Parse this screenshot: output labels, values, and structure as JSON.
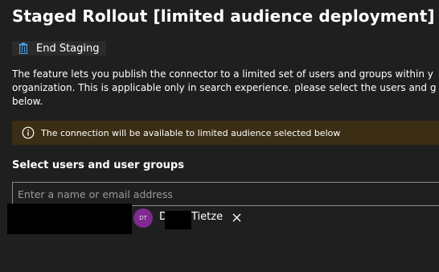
{
  "page": {
    "title": "Staged Rollout [limited audience deployment]"
  },
  "toolbar": {
    "end_staging_label": "End Staging",
    "end_staging_icon": "trash-icon"
  },
  "description": {
    "line1": "The feature lets you publish the connector to a limited set of users and groups within y",
    "line2": "organization. This is applicable only in search experience. please select the users and g",
    "line3": "below."
  },
  "banner": {
    "icon": "info-icon",
    "text": "The connection will be available to limited audience selected below",
    "background": "#3b2e15"
  },
  "selector": {
    "label": "Select users and user groups",
    "placeholder": "Enter a name or email address",
    "value": ""
  },
  "selected_users": [
    {
      "initials": "DT",
      "name_visible_prefix": "D",
      "name_visible_suffix": "Tietze",
      "avatar_color": "#7e2a8f",
      "remove_icon": "close-icon"
    }
  ],
  "colors": {
    "background": "#1f1f1f",
    "accent": "#4aa0e6",
    "input_border": "#8a8a8a"
  }
}
